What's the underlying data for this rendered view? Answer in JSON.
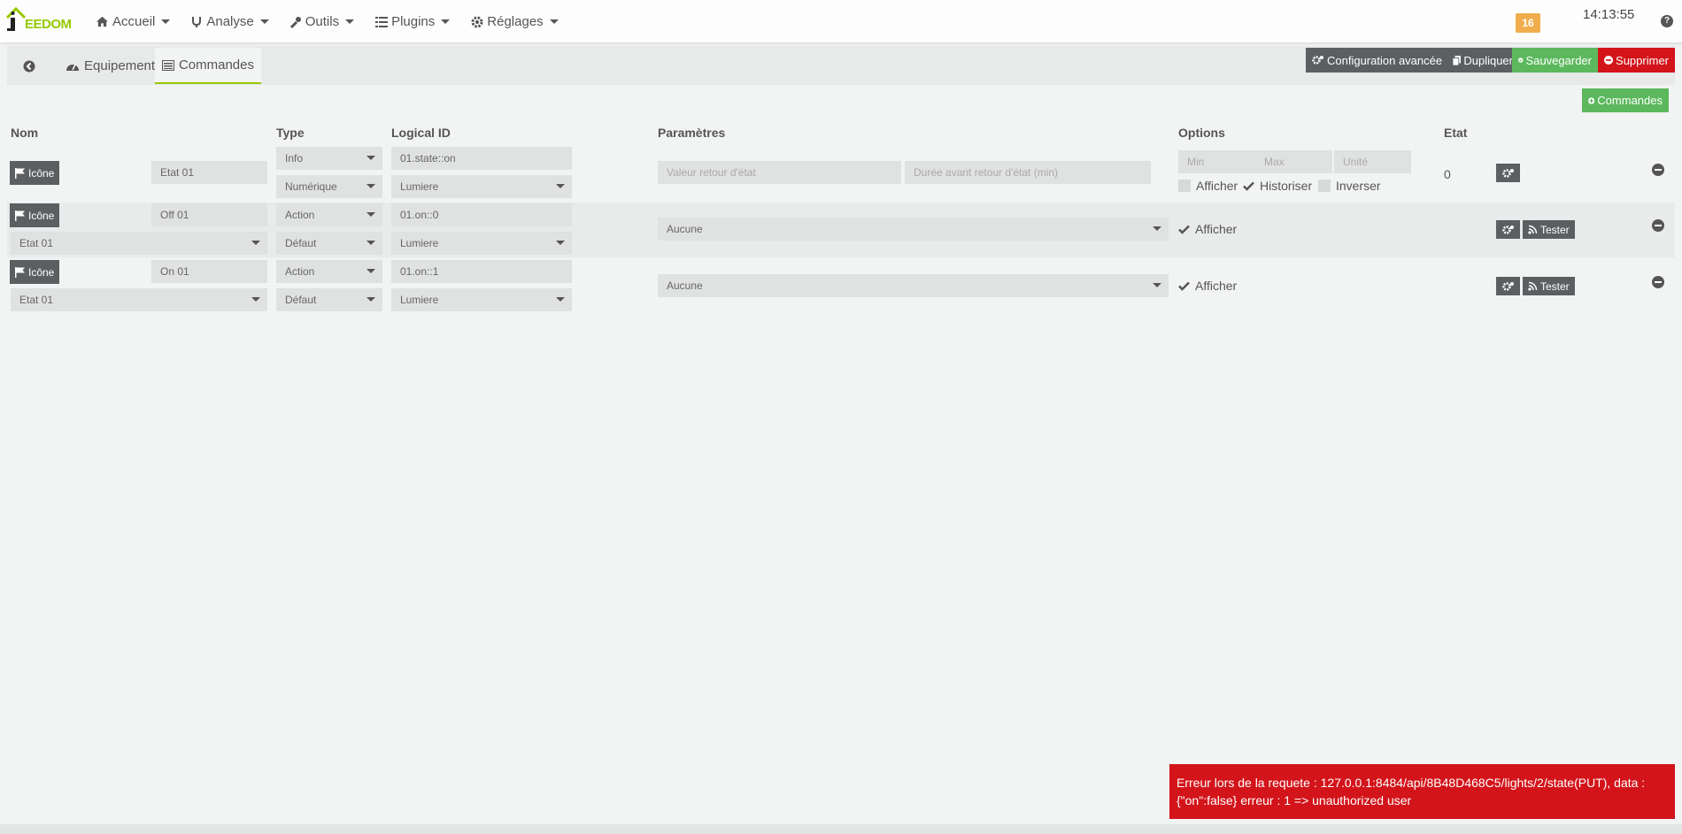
{
  "navbar": {
    "logo_text": "EEDOM",
    "menu": [
      {
        "label": "Accueil",
        "icon": "home-icon"
      },
      {
        "label": "Analyse",
        "icon": "stethoscope-icon"
      },
      {
        "label": "Outils",
        "icon": "wrench-icon"
      },
      {
        "label": "Plugins",
        "icon": "list-icon"
      },
      {
        "label": "Réglages",
        "icon": "cog-icon"
      }
    ],
    "badge": "16",
    "clock": "14:13:55",
    "help": "?"
  },
  "tabs": {
    "equipement": "Equipement",
    "commandes": "Commandes"
  },
  "actions": {
    "config": "Configuration avancée",
    "duplicate": "Dupliquer",
    "save": "Sauvegarder",
    "delete": "Supprimer",
    "add_command": "Commandes"
  },
  "colors": {
    "brand": "#94ca02",
    "dark_button": "#5b5f61",
    "success": "#5cb85c",
    "danger": "#d3141a",
    "warning": "#f0ad4e"
  },
  "table": {
    "headers": {
      "nom": "Nom",
      "type": "Type",
      "logical_id": "Logical ID",
      "parametres": "Paramètres",
      "options": "Options",
      "etat": "Etat"
    },
    "icon_label": "Icône",
    "rows": [
      {
        "name": "Etat 01",
        "type": "Info",
        "subtype": "Numérique",
        "logical_id": "01.state::on",
        "group": "Lumiere",
        "param1_placeholder": "Valeur retour d'état",
        "param2_placeholder": "Durée avant retour d'état (min)",
        "min_placeholder": "Min",
        "max_placeholder": "Max",
        "unit_placeholder": "Unité",
        "opt_afficher": "Afficher",
        "opt_historiser": "Historiser",
        "opt_inverser": "Inverser",
        "etat": "0"
      },
      {
        "name": "Off 01",
        "value": "Etat 01",
        "type": "Action",
        "subtype": "Défaut",
        "logical_id": "01.on::0",
        "group": "Lumiere",
        "param": "Aucune",
        "opt_afficher": "Afficher",
        "tester": "Tester"
      },
      {
        "name": "On 01",
        "value": "Etat 01",
        "type": "Action",
        "subtype": "Défaut",
        "logical_id": "01.on::1",
        "group": "Lumiere",
        "param": "Aucune",
        "opt_afficher": "Afficher",
        "tester": "Tester"
      }
    ]
  },
  "error": {
    "line1": "Erreur lors de la requete : 127.0.0.1:8484/api/8B48D468C5/lights/2/state(PUT), data :",
    "line2": "{\"on\":false} erreur : 1 => unauthorized user"
  }
}
